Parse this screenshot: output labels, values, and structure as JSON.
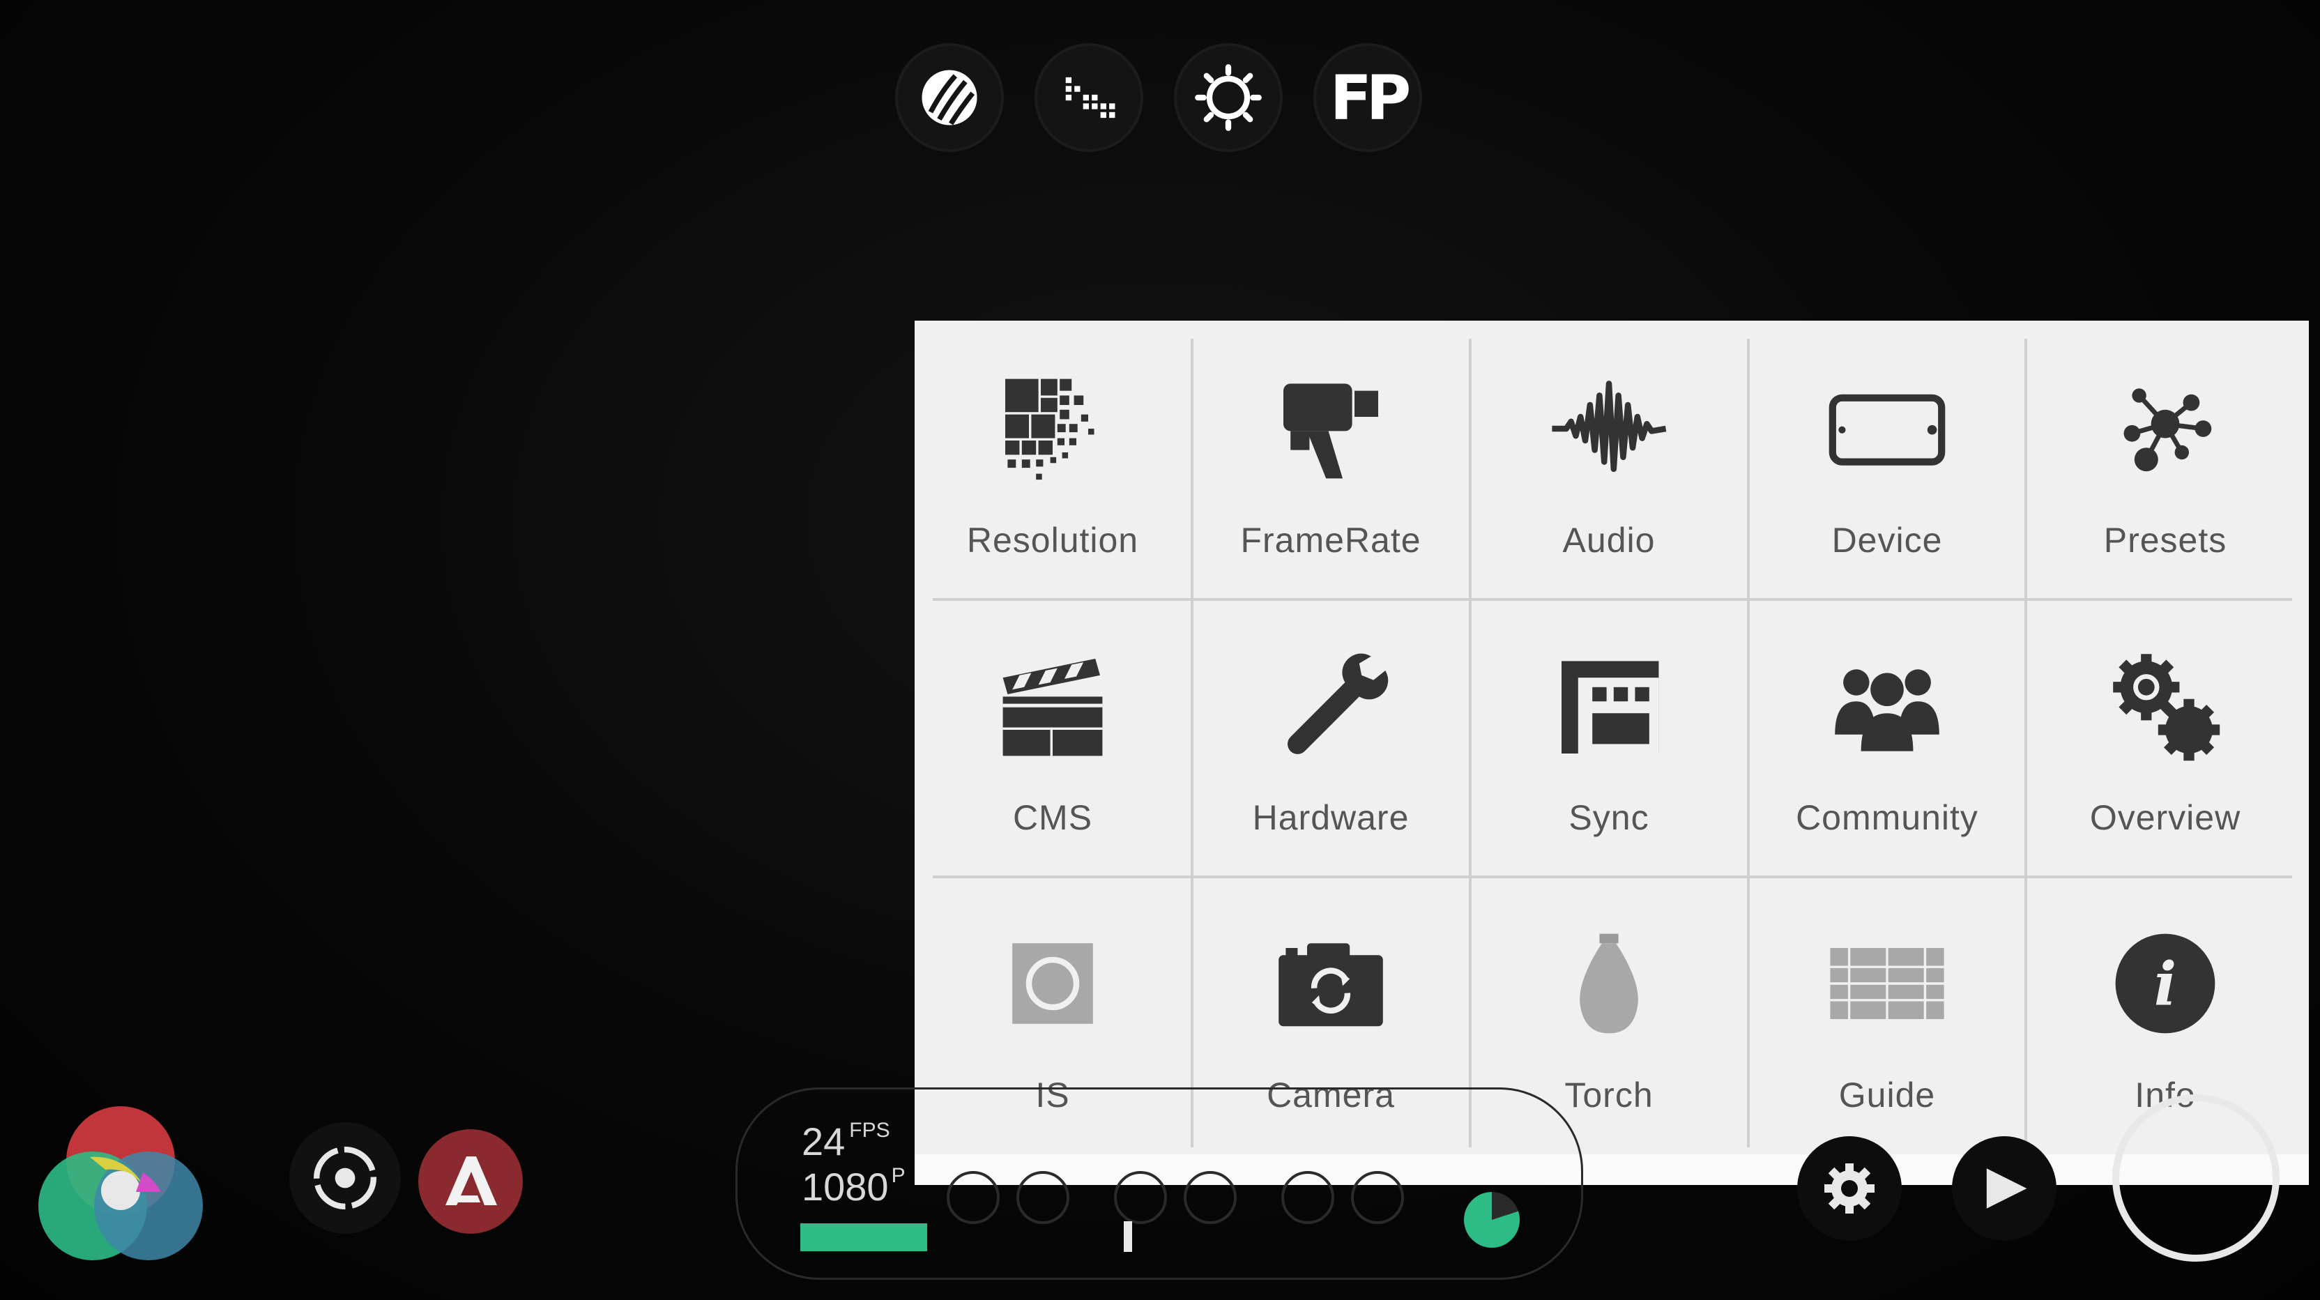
{
  "top_toolbar": {
    "buttons": [
      {
        "icon": "zebra-icon"
      },
      {
        "icon": "false-color-icon"
      },
      {
        "icon": "exposure-icon"
      },
      {
        "icon": "fp-icon",
        "text": "FP"
      }
    ]
  },
  "menu": {
    "items": [
      {
        "label": "Resolution",
        "icon": "resolution-icon"
      },
      {
        "label": "FrameRate",
        "icon": "camcorder-icon"
      },
      {
        "label": "Audio",
        "icon": "waveform-icon"
      },
      {
        "label": "Device",
        "icon": "device-icon"
      },
      {
        "label": "Presets",
        "icon": "presets-icon"
      },
      {
        "label": "CMS",
        "icon": "clapperboard-icon"
      },
      {
        "label": "Hardware",
        "icon": "wrench-icon"
      },
      {
        "label": "Sync",
        "icon": "sync-icon"
      },
      {
        "label": "Community",
        "icon": "people-icon"
      },
      {
        "label": "Overview",
        "icon": "gears-icon"
      },
      {
        "label": "IS",
        "icon": "stabilizer-icon"
      },
      {
        "label": "Camera",
        "icon": "camera-switch-icon"
      },
      {
        "label": "Torch",
        "icon": "torch-icon"
      },
      {
        "label": "Guide",
        "icon": "grid-guide-icon"
      },
      {
        "label": "Info",
        "icon": "info-icon"
      }
    ]
  },
  "status": {
    "fps_value": "24",
    "fps_unit": "FPS",
    "resolution_value": "1080",
    "resolution_unit": "P",
    "level_fraction": 0.3,
    "storage_fraction": 0.8
  },
  "colors": {
    "accent_green": "#2dbb86",
    "auto_button": "#8b2a2e",
    "panel_bg": "#f0f0f0",
    "icon_dark": "#333333"
  }
}
